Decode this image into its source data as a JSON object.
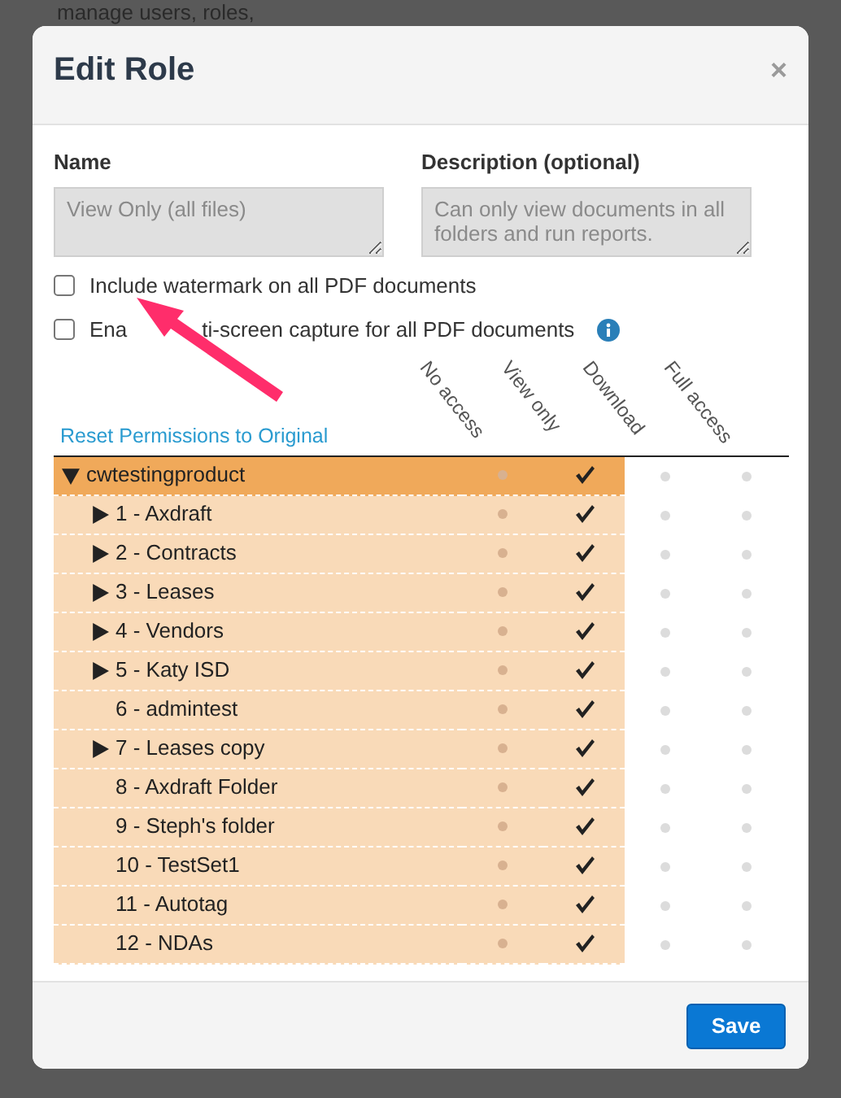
{
  "background_text": "manage users, roles,",
  "modal": {
    "title": "Edit Role",
    "close": "×",
    "name": {
      "label": "Name",
      "placeholder": "View Only (all files)"
    },
    "description": {
      "label": "Description (optional)",
      "placeholder": "Can only view documents in all folders and run reports."
    },
    "options": [
      {
        "label_parts": [
          "Include watermark on all PDF documents"
        ],
        "checked": false,
        "info": false
      },
      {
        "label_parts": [
          "Ena",
          "ti-screen capture for all PDF documents"
        ],
        "checked": false,
        "info": true
      }
    ],
    "reset_link": "Reset Permissions to Original",
    "columns": [
      "No access",
      "View only",
      "Download",
      "Full access"
    ],
    "tree": {
      "name": "cwtestingproduct",
      "kind": "folder",
      "expanded": true,
      "cells": [
        {
          "selected": false
        },
        {
          "selected": true
        },
        {
          "selected": false
        },
        {
          "selected": false
        }
      ],
      "children": [
        {
          "name": "1 - Axdraft",
          "kind": "folder",
          "expanded": false,
          "cells": [
            {
              "selected": false
            },
            {
              "selected": true
            },
            {
              "selected": false
            },
            {
              "selected": false
            }
          ]
        },
        {
          "name": "2 - Contracts",
          "kind": "folder",
          "expanded": false,
          "cells": [
            {
              "selected": false
            },
            {
              "selected": true
            },
            {
              "selected": false
            },
            {
              "selected": false
            }
          ]
        },
        {
          "name": "3 - Leases",
          "kind": "folder",
          "expanded": false,
          "cells": [
            {
              "selected": false
            },
            {
              "selected": true
            },
            {
              "selected": false
            },
            {
              "selected": false
            }
          ]
        },
        {
          "name": "4 - Vendors",
          "kind": "folder",
          "expanded": false,
          "cells": [
            {
              "selected": false
            },
            {
              "selected": true
            },
            {
              "selected": false
            },
            {
              "selected": false
            }
          ]
        },
        {
          "name": "5 - Katy ISD",
          "kind": "folder",
          "expanded": false,
          "cells": [
            {
              "selected": false
            },
            {
              "selected": true
            },
            {
              "selected": false
            },
            {
              "selected": false
            }
          ]
        },
        {
          "name": "6 - admintest",
          "kind": "leaf",
          "cells": [
            {
              "selected": false
            },
            {
              "selected": true
            },
            {
              "selected": false
            },
            {
              "selected": false
            }
          ]
        },
        {
          "name": "7 - Leases copy",
          "kind": "folder",
          "expanded": false,
          "cells": [
            {
              "selected": false
            },
            {
              "selected": true
            },
            {
              "selected": false
            },
            {
              "selected": false
            }
          ]
        },
        {
          "name": "8 - Axdraft Folder",
          "kind": "leaf",
          "cells": [
            {
              "selected": false
            },
            {
              "selected": true
            },
            {
              "selected": false
            },
            {
              "selected": false
            }
          ]
        },
        {
          "name": "9 - Steph's folder",
          "kind": "leaf",
          "cells": [
            {
              "selected": false
            },
            {
              "selected": true
            },
            {
              "selected": false
            },
            {
              "selected": false
            }
          ]
        },
        {
          "name": "10 - TestSet1",
          "kind": "leaf",
          "cells": [
            {
              "selected": false
            },
            {
              "selected": true
            },
            {
              "selected": false
            },
            {
              "selected": false
            }
          ]
        },
        {
          "name": "11 - Autotag",
          "kind": "leaf",
          "cells": [
            {
              "selected": false
            },
            {
              "selected": true
            },
            {
              "selected": false
            },
            {
              "selected": false
            }
          ]
        },
        {
          "name": "12 - NDAs",
          "kind": "leaf",
          "cells": [
            {
              "selected": false
            },
            {
              "selected": true
            },
            {
              "selected": false
            },
            {
              "selected": false
            }
          ]
        }
      ]
    },
    "save": "Save"
  }
}
